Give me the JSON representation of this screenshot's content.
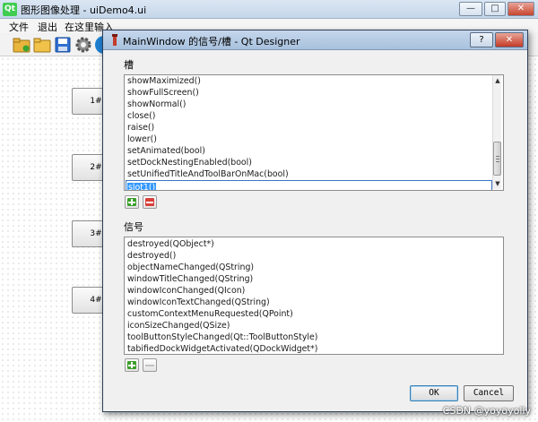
{
  "main_window": {
    "logo": "Qt",
    "title": "图形图像处理 - uiDemo4.ui",
    "controls": {
      "minimize": "—",
      "maximize": "□",
      "close": "✕"
    }
  },
  "menubar": {
    "items": [
      "文件",
      "退出",
      "在这里输入"
    ]
  },
  "toolbar": {
    "icons": [
      "open-folder-icon",
      "folder-icon",
      "save-icon",
      "gear-icon"
    ]
  },
  "form_buttons": [
    {
      "label": "1#"
    },
    {
      "label": "2#"
    },
    {
      "label": "3#"
    },
    {
      "label": "4#"
    }
  ],
  "dialog": {
    "title": "MainWindow 的信号/槽 - Qt Designer",
    "help_label": "?",
    "close_label": "✕",
    "slots_group_label": "槽",
    "slots": [
      "showMaximized()",
      "showFullScreen()",
      "showNormal()",
      "close()",
      "raise()",
      "lower()",
      "setAnimated(bool)",
      "setDockNestingEnabled(bool)",
      "setUnifiedTitleAndToolBarOnMac(bool)"
    ],
    "editing_slot": "slot1()",
    "signals_group_label": "信号",
    "signals": [
      "destroyed(QObject*)",
      "destroyed()",
      "objectNameChanged(QString)",
      "windowTitleChanged(QString)",
      "windowIconChanged(QIcon)",
      "windowIconTextChanged(QString)",
      "customContextMenuRequested(QPoint)",
      "iconSizeChanged(QSize)",
      "toolButtonStyleChanged(Qt::ToolButtonStyle)",
      "tabifiedDockWidgetActivated(QDockWidget*)"
    ],
    "ok_label": "OK",
    "cancel_label": "Cancel"
  },
  "watermark": "CSDN @yoyoyolly",
  "colors": {
    "accent": "#3399ff",
    "add_green": "#3c9e2b",
    "remove_red": "#d9403a",
    "titlebar": "#c5d7ec"
  }
}
